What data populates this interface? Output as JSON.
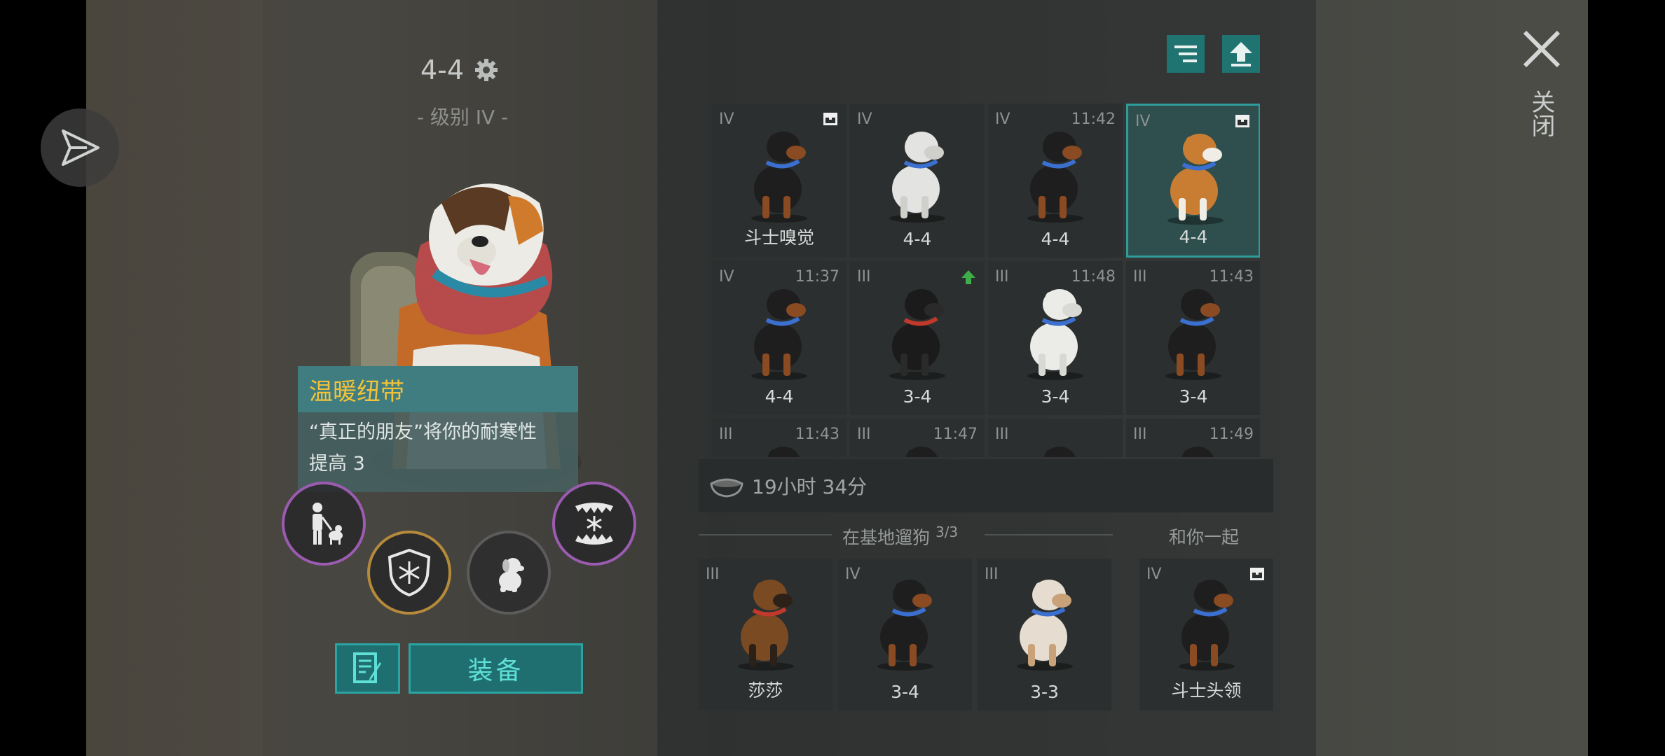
{
  "dog": {
    "title": "4-4",
    "level": "- 级别 IV -"
  },
  "tooltip": {
    "title": "温暖纽带",
    "desc_line1": "“真正的朋友”将你的耐寒性",
    "desc_line2": "提高 3"
  },
  "buttons": {
    "equip": "装备"
  },
  "grid": [
    {
      "tier": "IV",
      "time": "",
      "name": "斗士嗅觉",
      "badge": "chest",
      "coat": "rott"
    },
    {
      "tier": "IV",
      "time": "",
      "name": "4-4",
      "badge": "",
      "coat": "white"
    },
    {
      "tier": "IV",
      "time": "11:42",
      "name": "4-4",
      "badge": "",
      "coat": "rott"
    },
    {
      "tier": "IV",
      "time": "",
      "name": "4-4",
      "badge": "chest",
      "coat": "stbernard",
      "selected": true
    },
    {
      "tier": "IV",
      "time": "11:37",
      "name": "4-4",
      "badge": "",
      "coat": "rott"
    },
    {
      "tier": "III",
      "time": "",
      "name": "3-4",
      "badge": "up",
      "coat": "black"
    },
    {
      "tier": "III",
      "time": "11:48",
      "name": "3-4",
      "badge": "",
      "coat": "whitepup"
    },
    {
      "tier": "III",
      "time": "11:43",
      "name": "3-4",
      "badge": "",
      "coat": "rott"
    },
    {
      "tier": "III",
      "time": "11:43",
      "name": "",
      "badge": "",
      "coat": "rott"
    },
    {
      "tier": "III",
      "time": "11:47",
      "name": "",
      "badge": "",
      "coat": "rott"
    },
    {
      "tier": "III",
      "time": "",
      "name": "",
      "badge": "",
      "coat": "rott"
    },
    {
      "tier": "III",
      "time": "11:49",
      "name": "",
      "badge": "",
      "coat": "rott"
    }
  ],
  "food": {
    "time_left": "19小时 34分"
  },
  "walking": {
    "label": "在基地遛狗",
    "count": "3/3",
    "dogs": [
      {
        "tier": "III",
        "name": "莎莎",
        "coat": "shepherd"
      },
      {
        "tier": "IV",
        "name": "3-4",
        "coat": "rott"
      },
      {
        "tier": "III",
        "name": "3-3",
        "coat": "husky"
      }
    ]
  },
  "with_you": {
    "label": "和你一起",
    "dog": {
      "tier": "IV",
      "name": "斗士头领",
      "coat": "rott",
      "badge": "chest"
    }
  },
  "close": {
    "label": "关闭"
  },
  "colors": {
    "accent": "#2d9d9b",
    "tooltip_title": "#f2c23a",
    "frame_purple": "#9b5bb0",
    "frame_gold": "#b58a3a"
  },
  "icons": [
    "send-icon",
    "gear-icon",
    "sort-icon",
    "upgrade-icon",
    "chest-icon",
    "arrow-up-icon",
    "food-bowl-icon",
    "walker-dog-icon",
    "shield-snowflake-icon",
    "puppy-icon",
    "fangs-snowflake-icon",
    "note-icon",
    "close-icon"
  ]
}
